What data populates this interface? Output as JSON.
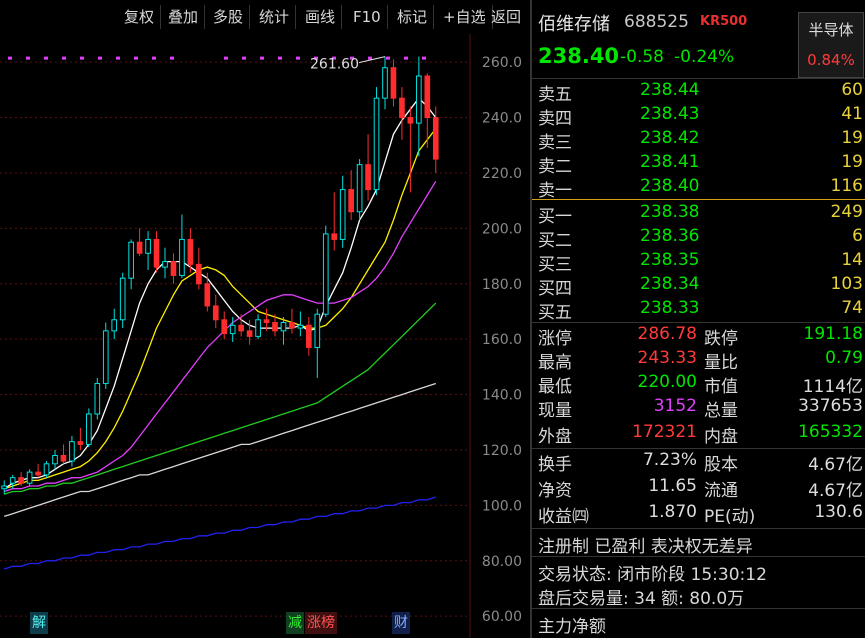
{
  "toolbar": {
    "buttons": [
      "复权",
      "叠加",
      "多股",
      "统计",
      "画线",
      "F10",
      "标记",
      "+自选",
      "返回"
    ]
  },
  "chart": {
    "y_ticks": [
      "260.0",
      "240.0",
      "220.0",
      "200.0",
      "180.0",
      "160.0",
      "140.0",
      "120.0",
      "100.0",
      "80.00",
      "60.00"
    ],
    "high_marker": "261.60",
    "bottom_tags": [
      "解",
      "减",
      "涨榜",
      "财"
    ]
  },
  "chart_data": {
    "type": "candlestick",
    "ylim": [
      55,
      268
    ],
    "candles": [
      [
        106,
        109,
        104,
        107
      ],
      [
        108,
        111,
        106,
        110
      ],
      [
        110,
        112,
        107,
        108
      ],
      [
        108,
        113,
        107,
        112
      ],
      [
        112,
        115,
        110,
        111
      ],
      [
        111,
        116,
        110,
        115
      ],
      [
        115,
        120,
        113,
        118
      ],
      [
        118,
        122,
        115,
        116
      ],
      [
        116,
        125,
        114,
        123
      ],
      [
        123,
        128,
        120,
        122
      ],
      [
        122,
        135,
        121,
        133
      ],
      [
        133,
        146,
        131,
        144
      ],
      [
        144,
        166,
        142,
        163
      ],
      [
        163,
        171,
        160,
        167
      ],
      [
        167,
        184,
        164,
        182
      ],
      [
        182,
        196,
        178,
        195
      ],
      [
        195,
        200,
        190,
        191
      ],
      [
        191,
        199,
        185,
        196
      ],
      [
        196,
        199,
        184,
        186
      ],
      [
        186,
        193,
        182,
        188
      ],
      [
        188,
        191,
        180,
        183
      ],
      [
        183,
        205,
        182,
        196
      ],
      [
        196,
        200,
        184,
        187
      ],
      [
        187,
        193,
        178,
        180
      ],
      [
        180,
        184,
        170,
        172
      ],
      [
        172,
        176,
        164,
        167
      ],
      [
        167,
        170,
        160,
        162
      ],
      [
        162,
        168,
        159,
        165
      ],
      [
        165,
        169,
        161,
        163
      ],
      [
        163,
        167,
        158,
        161
      ],
      [
        161,
        169,
        160,
        167
      ],
      [
        167,
        171,
        163,
        166
      ],
      [
        166,
        169,
        161,
        163
      ],
      [
        163,
        168,
        158,
        166
      ],
      [
        166,
        171,
        162,
        164
      ],
      [
        164,
        170,
        161,
        165
      ],
      [
        165,
        168,
        154,
        157
      ],
      [
        157,
        171,
        146,
        169
      ],
      [
        169,
        201,
        168,
        198
      ],
      [
        198,
        213,
        192,
        196
      ],
      [
        196,
        219,
        193,
        214
      ],
      [
        214,
        221,
        203,
        206
      ],
      [
        206,
        225,
        203,
        223
      ],
      [
        223,
        234,
        210,
        214
      ],
      [
        214,
        251,
        212,
        247
      ],
      [
        247,
        262,
        243,
        258
      ],
      [
        258,
        261,
        244,
        247
      ],
      [
        247,
        251,
        232,
        240
      ],
      [
        240,
        244,
        213,
        238
      ],
      [
        238,
        262,
        226,
        255
      ],
      [
        255,
        256,
        229,
        240
      ],
      [
        240,
        244,
        220,
        225
      ]
    ],
    "ma_lines": [
      {
        "name": "MA5",
        "color": "#ffffff",
        "values": [
          106,
          108,
          109,
          110,
          110,
          111,
          113,
          115,
          116,
          118,
          122,
          127,
          135,
          143,
          153,
          163,
          173,
          180,
          185,
          188,
          188,
          188,
          186,
          184,
          182,
          178,
          174,
          170,
          167,
          165,
          164,
          164,
          164,
          164,
          164,
          165,
          163,
          164,
          172,
          178,
          184,
          193,
          203,
          208,
          214,
          224,
          234,
          239,
          243,
          247,
          244,
          240
        ]
      },
      {
        "name": "MA10",
        "color": "#ffee00",
        "values": [
          106,
          107,
          108,
          109,
          109,
          110,
          111,
          112,
          113,
          114,
          116,
          119,
          123,
          128,
          134,
          141,
          148,
          156,
          164,
          170,
          176,
          181,
          183,
          185,
          186,
          185,
          183,
          179,
          176,
          173,
          170,
          169,
          168,
          167,
          166,
          165,
          164,
          164,
          165,
          168,
          171,
          175,
          180,
          185,
          190,
          195,
          203,
          212,
          220,
          228,
          232,
          236
        ]
      },
      {
        "name": "MA20",
        "color": "#e040fb",
        "values": [
          105,
          106,
          106,
          107,
          107,
          108,
          108,
          109,
          110,
          110,
          111,
          112,
          114,
          116,
          118,
          121,
          125,
          129,
          133,
          137,
          141,
          145,
          149,
          153,
          157,
          160,
          163,
          166,
          168,
          170,
          172,
          174,
          175,
          176,
          176,
          175,
          174,
          173,
          173,
          173,
          174,
          175,
          177,
          179,
          182,
          186,
          191,
          197,
          202,
          207,
          212,
          217
        ]
      },
      {
        "name": "MA60",
        "color": "#22cc22",
        "values": [
          104,
          105,
          105,
          106,
          106,
          107,
          107,
          108,
          108,
          109,
          110,
          111,
          112,
          113,
          114,
          115,
          116,
          117,
          118,
          119,
          120,
          121,
          122,
          123,
          124,
          125,
          126,
          127,
          128,
          129,
          130,
          131,
          132,
          133,
          134,
          135,
          136,
          137,
          139,
          141,
          143,
          145,
          147,
          149,
          152,
          155,
          158,
          161,
          164,
          167,
          170,
          173
        ]
      },
      {
        "name": "MA120",
        "color": "#d8d8d8",
        "values": [
          96,
          97,
          98,
          99,
          100,
          101,
          102,
          103,
          104,
          105,
          105,
          106,
          107,
          108,
          109,
          110,
          111,
          111,
          112,
          113,
          114,
          115,
          116,
          117,
          118,
          119,
          120,
          121,
          122,
          122,
          123,
          124,
          125,
          126,
          127,
          128,
          129,
          130,
          131,
          132,
          133,
          134,
          135,
          136,
          137,
          138,
          139,
          140,
          141,
          142,
          143,
          144
        ]
      },
      {
        "name": "MA250",
        "color": "#2222ee",
        "values": [
          77,
          78,
          78,
          79,
          79,
          80,
          80,
          81,
          81,
          82,
          82,
          83,
          83,
          84,
          84,
          85,
          85,
          86,
          86,
          87,
          87,
          88,
          88,
          89,
          89,
          90,
          90,
          91,
          91,
          92,
          92,
          93,
          93,
          94,
          94,
          95,
          95,
          96,
          96,
          97,
          97,
          98,
          98,
          99,
          99,
          100,
          100,
          101,
          101,
          102,
          102,
          103
        ]
      }
    ]
  },
  "panel": {
    "name": "佰维存储",
    "code": "688525",
    "tag": "KR500",
    "sector": "半导体",
    "sector_pct": "0.84%",
    "price": "238.40",
    "change": "-0.58",
    "change_pct": "-0.24%",
    "asks": [
      {
        "label": "卖五",
        "price": "238.44",
        "vol": "60"
      },
      {
        "label": "卖四",
        "price": "238.43",
        "vol": "41"
      },
      {
        "label": "卖三",
        "price": "238.42",
        "vol": "19"
      },
      {
        "label": "卖二",
        "price": "238.41",
        "vol": "19"
      },
      {
        "label": "卖一",
        "price": "238.40",
        "vol": "116"
      }
    ],
    "bids": [
      {
        "label": "买一",
        "price": "238.38",
        "vol": "249"
      },
      {
        "label": "买二",
        "price": "238.36",
        "vol": "6"
      },
      {
        "label": "买三",
        "price": "238.35",
        "vol": "14"
      },
      {
        "label": "买四",
        "price": "238.34",
        "vol": "103"
      },
      {
        "label": "买五",
        "price": "238.33",
        "vol": "74"
      }
    ],
    "stats": [
      {
        "k1": "涨停",
        "v1": "286.78",
        "c1": "red",
        "k2": "跌停",
        "v2": "191.18",
        "c2": "green"
      },
      {
        "k1": "最高",
        "v1": "243.33",
        "c1": "red",
        "k2": "量比",
        "v2": "0.79",
        "c2": "green"
      },
      {
        "k1": "最低",
        "v1": "220.00",
        "c1": "green",
        "k2": "市值",
        "v2": "1114亿",
        "c2": "white"
      },
      {
        "k1": "现量",
        "v1": "3152",
        "c1": "mag",
        "k2": "总量",
        "v2": "337653",
        "c2": "white"
      },
      {
        "k1": "外盘",
        "v1": "172321",
        "c1": "red",
        "k2": "内盘",
        "v2": "165332",
        "c2": "green"
      }
    ],
    "finance": [
      {
        "k1": "换手",
        "v1": "7.23%",
        "k2": "股本",
        "v2": "4.67亿"
      },
      {
        "k1": "净资",
        "v1": "11.65",
        "k2": "流通",
        "v2": "4.67亿"
      },
      {
        "k1": "收益㈣",
        "v1": "1.870",
        "k2": "PE(动)",
        "v2": "130.6"
      }
    ],
    "register": "注册制 已盈利 表决权无差异",
    "trade_status": "交易状态: 闭市阶段 15:30:12",
    "after_hours": "盘后交易量: 34  额: 80.0万",
    "main_flow": "主力净额"
  }
}
